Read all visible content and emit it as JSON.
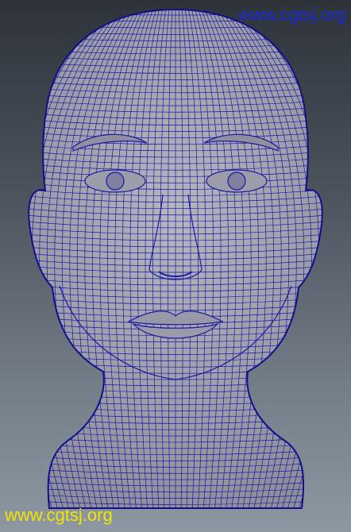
{
  "watermark_top": "www.cgtsj.org",
  "watermark_bottom": "www.cgtsj.org",
  "colors": {
    "wireframe": "#1a1aa0",
    "skin": "#a7a7b2",
    "watermark_top": "#1c2ad6",
    "watermark_bottom": "#f2e600"
  },
  "subject": "head-wireframe-render"
}
